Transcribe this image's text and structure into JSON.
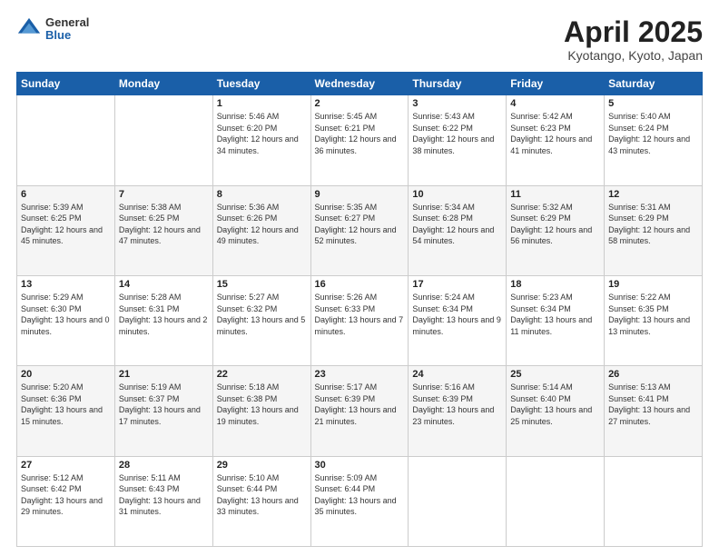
{
  "header": {
    "logo": {
      "general": "General",
      "blue": "Blue"
    },
    "title": "April 2025",
    "subtitle": "Kyotango, Kyoto, Japan"
  },
  "days_of_week": [
    "Sunday",
    "Monday",
    "Tuesday",
    "Wednesday",
    "Thursday",
    "Friday",
    "Saturday"
  ],
  "weeks": [
    [
      {
        "num": "",
        "info": ""
      },
      {
        "num": "",
        "info": ""
      },
      {
        "num": "1",
        "info": "Sunrise: 5:46 AM\nSunset: 6:20 PM\nDaylight: 12 hours and 34 minutes."
      },
      {
        "num": "2",
        "info": "Sunrise: 5:45 AM\nSunset: 6:21 PM\nDaylight: 12 hours and 36 minutes."
      },
      {
        "num": "3",
        "info": "Sunrise: 5:43 AM\nSunset: 6:22 PM\nDaylight: 12 hours and 38 minutes."
      },
      {
        "num": "4",
        "info": "Sunrise: 5:42 AM\nSunset: 6:23 PM\nDaylight: 12 hours and 41 minutes."
      },
      {
        "num": "5",
        "info": "Sunrise: 5:40 AM\nSunset: 6:24 PM\nDaylight: 12 hours and 43 minutes."
      }
    ],
    [
      {
        "num": "6",
        "info": "Sunrise: 5:39 AM\nSunset: 6:25 PM\nDaylight: 12 hours and 45 minutes."
      },
      {
        "num": "7",
        "info": "Sunrise: 5:38 AM\nSunset: 6:25 PM\nDaylight: 12 hours and 47 minutes."
      },
      {
        "num": "8",
        "info": "Sunrise: 5:36 AM\nSunset: 6:26 PM\nDaylight: 12 hours and 49 minutes."
      },
      {
        "num": "9",
        "info": "Sunrise: 5:35 AM\nSunset: 6:27 PM\nDaylight: 12 hours and 52 minutes."
      },
      {
        "num": "10",
        "info": "Sunrise: 5:34 AM\nSunset: 6:28 PM\nDaylight: 12 hours and 54 minutes."
      },
      {
        "num": "11",
        "info": "Sunrise: 5:32 AM\nSunset: 6:29 PM\nDaylight: 12 hours and 56 minutes."
      },
      {
        "num": "12",
        "info": "Sunrise: 5:31 AM\nSunset: 6:29 PM\nDaylight: 12 hours and 58 minutes."
      }
    ],
    [
      {
        "num": "13",
        "info": "Sunrise: 5:29 AM\nSunset: 6:30 PM\nDaylight: 13 hours and 0 minutes."
      },
      {
        "num": "14",
        "info": "Sunrise: 5:28 AM\nSunset: 6:31 PM\nDaylight: 13 hours and 2 minutes."
      },
      {
        "num": "15",
        "info": "Sunrise: 5:27 AM\nSunset: 6:32 PM\nDaylight: 13 hours and 5 minutes."
      },
      {
        "num": "16",
        "info": "Sunrise: 5:26 AM\nSunset: 6:33 PM\nDaylight: 13 hours and 7 minutes."
      },
      {
        "num": "17",
        "info": "Sunrise: 5:24 AM\nSunset: 6:34 PM\nDaylight: 13 hours and 9 minutes."
      },
      {
        "num": "18",
        "info": "Sunrise: 5:23 AM\nSunset: 6:34 PM\nDaylight: 13 hours and 11 minutes."
      },
      {
        "num": "19",
        "info": "Sunrise: 5:22 AM\nSunset: 6:35 PM\nDaylight: 13 hours and 13 minutes."
      }
    ],
    [
      {
        "num": "20",
        "info": "Sunrise: 5:20 AM\nSunset: 6:36 PM\nDaylight: 13 hours and 15 minutes."
      },
      {
        "num": "21",
        "info": "Sunrise: 5:19 AM\nSunset: 6:37 PM\nDaylight: 13 hours and 17 minutes."
      },
      {
        "num": "22",
        "info": "Sunrise: 5:18 AM\nSunset: 6:38 PM\nDaylight: 13 hours and 19 minutes."
      },
      {
        "num": "23",
        "info": "Sunrise: 5:17 AM\nSunset: 6:39 PM\nDaylight: 13 hours and 21 minutes."
      },
      {
        "num": "24",
        "info": "Sunrise: 5:16 AM\nSunset: 6:39 PM\nDaylight: 13 hours and 23 minutes."
      },
      {
        "num": "25",
        "info": "Sunrise: 5:14 AM\nSunset: 6:40 PM\nDaylight: 13 hours and 25 minutes."
      },
      {
        "num": "26",
        "info": "Sunrise: 5:13 AM\nSunset: 6:41 PM\nDaylight: 13 hours and 27 minutes."
      }
    ],
    [
      {
        "num": "27",
        "info": "Sunrise: 5:12 AM\nSunset: 6:42 PM\nDaylight: 13 hours and 29 minutes."
      },
      {
        "num": "28",
        "info": "Sunrise: 5:11 AM\nSunset: 6:43 PM\nDaylight: 13 hours and 31 minutes."
      },
      {
        "num": "29",
        "info": "Sunrise: 5:10 AM\nSunset: 6:44 PM\nDaylight: 13 hours and 33 minutes."
      },
      {
        "num": "30",
        "info": "Sunrise: 5:09 AM\nSunset: 6:44 PM\nDaylight: 13 hours and 35 minutes."
      },
      {
        "num": "",
        "info": ""
      },
      {
        "num": "",
        "info": ""
      },
      {
        "num": "",
        "info": ""
      }
    ]
  ]
}
